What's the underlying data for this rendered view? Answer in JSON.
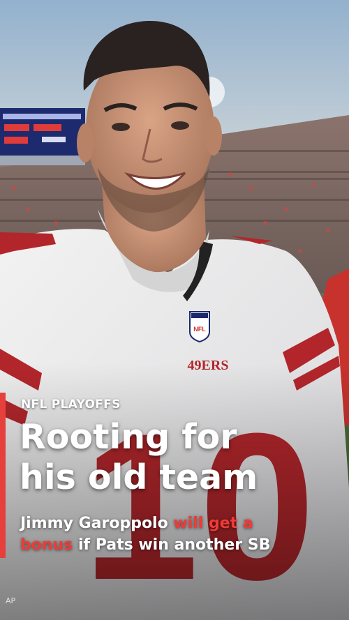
{
  "kicker": "NFL PLAYOFFS",
  "headline": {
    "line1": "Rooting for",
    "line2": "his old team"
  },
  "subheadline": {
    "part1": "Jimmy Garoppolo ",
    "highlight1": "will get a",
    "highlight2": "bonus",
    "part2": " if Pats win another SB"
  },
  "jersey": {
    "team_wordmark": "49ERS",
    "number": "10",
    "logo_text": "NFL"
  },
  "scoreboard": {
    "url_text": "ERAMS.COM/TI"
  },
  "photo_credit": "AP",
  "colors": {
    "accent_red": "#e5403b",
    "text": "#ffffff",
    "jersey_red": "#b2262b"
  }
}
